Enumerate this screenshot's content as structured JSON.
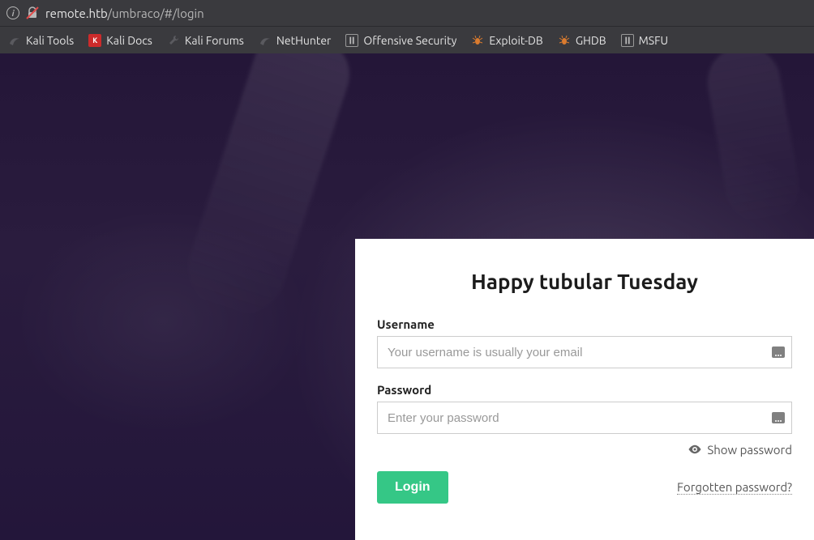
{
  "address_bar": {
    "url_prefix": "remote.htb",
    "url_suffix": "/umbraco/#/login"
  },
  "bookmarks": [
    {
      "label": "Kali Tools",
      "icon": "dragon-icon"
    },
    {
      "label": "Kali Docs",
      "icon": "kali-docs-icon"
    },
    {
      "label": "Kali Forums",
      "icon": "wrench-icon"
    },
    {
      "label": "NetHunter",
      "icon": "dragon-icon"
    },
    {
      "label": "Offensive Security",
      "icon": "offsec-icon"
    },
    {
      "label": "Exploit-DB",
      "icon": "spider-icon"
    },
    {
      "label": "GHDB",
      "icon": "spider-icon"
    },
    {
      "label": "MSFU",
      "icon": "offsec-icon"
    }
  ],
  "login": {
    "greeting": "Happy tubular Tuesday",
    "username_label": "Username",
    "username_placeholder": "Your username is usually your email",
    "username_value": "",
    "password_label": "Password",
    "password_placeholder": "Enter your password",
    "password_value": "",
    "show_password_label": "Show password",
    "login_button_label": "Login",
    "forgot_label": "Forgotten password?"
  }
}
